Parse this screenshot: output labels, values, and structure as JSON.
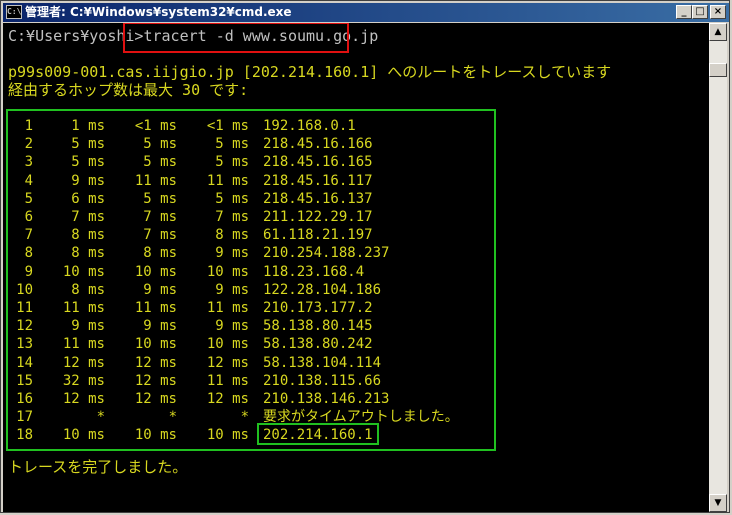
{
  "window": {
    "title": "管理者: C:¥Windows¥system32¥cmd.exe",
    "minimize": "_",
    "maximize": "□",
    "close": "×"
  },
  "console": {
    "prompt": "C:¥Users¥yoshi>",
    "command": "tracert -d www.soumu.go.jp",
    "header_line1": "p99s009-001.cas.iijgio.jp [202.214.160.1] へのルートをトレースしています",
    "header_line2": "経由するホップ数は最大 30 です:",
    "hops": [
      {
        "hop": "1",
        "t1": "1 ms",
        "t2": "<1 ms",
        "t3": "<1 ms",
        "addr": "192.168.0.1"
      },
      {
        "hop": "2",
        "t1": "5 ms",
        "t2": "5 ms",
        "t3": "5 ms",
        "addr": "218.45.16.166"
      },
      {
        "hop": "3",
        "t1": "5 ms",
        "t2": "5 ms",
        "t3": "5 ms",
        "addr": "218.45.16.165"
      },
      {
        "hop": "4",
        "t1": "9 ms",
        "t2": "11 ms",
        "t3": "11 ms",
        "addr": "218.45.16.117"
      },
      {
        "hop": "5",
        "t1": "6 ms",
        "t2": "5 ms",
        "t3": "5 ms",
        "addr": "218.45.16.137"
      },
      {
        "hop": "6",
        "t1": "7 ms",
        "t2": "7 ms",
        "t3": "7 ms",
        "addr": "211.122.29.17"
      },
      {
        "hop": "7",
        "t1": "8 ms",
        "t2": "7 ms",
        "t3": "8 ms",
        "addr": "61.118.21.197"
      },
      {
        "hop": "8",
        "t1": "8 ms",
        "t2": "8 ms",
        "t3": "9 ms",
        "addr": "210.254.188.237"
      },
      {
        "hop": "9",
        "t1": "10 ms",
        "t2": "10 ms",
        "t3": "10 ms",
        "addr": "118.23.168.4"
      },
      {
        "hop": "10",
        "t1": "8 ms",
        "t2": "9 ms",
        "t3": "9 ms",
        "addr": "122.28.104.186"
      },
      {
        "hop": "11",
        "t1": "11 ms",
        "t2": "11 ms",
        "t3": "11 ms",
        "addr": "210.173.177.2"
      },
      {
        "hop": "12",
        "t1": "9 ms",
        "t2": "9 ms",
        "t3": "9 ms",
        "addr": "58.138.80.145"
      },
      {
        "hop": "13",
        "t1": "11 ms",
        "t2": "10 ms",
        "t3": "10 ms",
        "addr": "58.138.80.242"
      },
      {
        "hop": "14",
        "t1": "12 ms",
        "t2": "12 ms",
        "t3": "12 ms",
        "addr": "58.138.104.114"
      },
      {
        "hop": "15",
        "t1": "32 ms",
        "t2": "12 ms",
        "t3": "11 ms",
        "addr": "210.138.115.66"
      },
      {
        "hop": "16",
        "t1": "12 ms",
        "t2": "12 ms",
        "t3": "12 ms",
        "addr": "210.138.146.213"
      },
      {
        "hop": "17",
        "t1": "*",
        "t2": "*",
        "t3": "*",
        "addr": "要求がタイムアウトしました。"
      },
      {
        "hop": "18",
        "t1": "10 ms",
        "t2": "10 ms",
        "t3": "10 ms",
        "addr": "202.214.160.1"
      }
    ],
    "footer": "トレースを完了しました。"
  },
  "colors": {
    "console_bg": "#000000",
    "text_default": "#c0c0c0",
    "text_yellow": "#d8d820",
    "highlight_red": "#e01010",
    "highlight_green": "#20c020"
  }
}
